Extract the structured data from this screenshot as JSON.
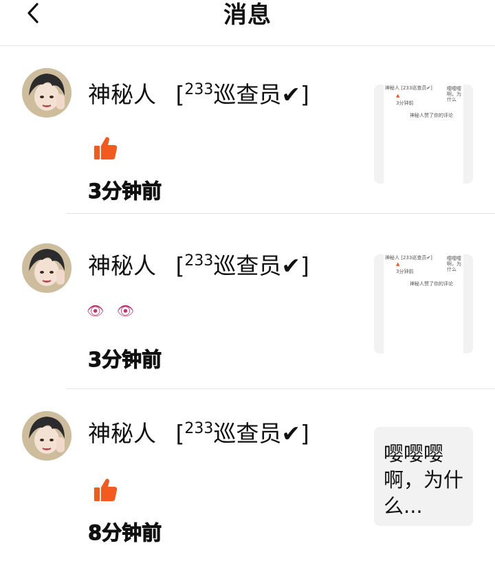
{
  "header": {
    "title": "消息",
    "back_icon": "chevron-left-icon"
  },
  "badge": {
    "prefix": "[",
    "sup": "233",
    "text": "巡查员✔",
    "suffix": "]"
  },
  "items": [
    {
      "name": "神秘人",
      "reaction": "thumbs-up-icon",
      "time": "3分钟前",
      "preview": {
        "type": "screenshot",
        "mini_name": "神秘人 [233巡查员✔]",
        "mini_side": "嘤嘤嘤 啊，为 什么",
        "mini_time": "3分钟前",
        "mini_caption": "神秘人赞了你的评论"
      }
    },
    {
      "name": "神秘人",
      "reaction": "eyes-emoji",
      "reaction_text": "👁 👁",
      "time": "3分钟前",
      "preview": {
        "type": "screenshot",
        "mini_name": "神秘人 [233巡查员✔]",
        "mini_side": "嘤嘤嘤 啊，为 什么",
        "mini_time": "3分钟前",
        "mini_caption": "神秘人赞了你的评论"
      }
    },
    {
      "name": "神秘人",
      "reaction": "thumbs-up-icon",
      "time": "8分钟前",
      "preview": {
        "type": "text",
        "text": "嘤嘤嘤啊，为什么..."
      }
    }
  ],
  "colors": {
    "thumb_orange": "#f25a1e",
    "eyes_pink": "#c43070",
    "divider": "#e6e6e6"
  }
}
